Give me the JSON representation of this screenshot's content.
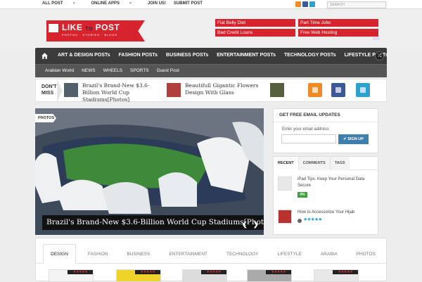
{
  "topbar": {
    "nav": [
      {
        "label": "ALL POST",
        "dropdown": true
      },
      {
        "label": "ONLINE APPS",
        "dropdown": true
      },
      {
        "label": "JOIN US!",
        "dropdown": false
      },
      {
        "label": "SUBMIT POST",
        "dropdown": false
      }
    ],
    "social_icons": [
      "rss-icon",
      "facebook-icon",
      "twitter-icon"
    ],
    "search_placeholder": "SEARCH"
  },
  "logo": {
    "text_a": "LIKE",
    "text_to": "TO",
    "text_b": "POST",
    "tagline": "PHOTOS · STORIES · BLOGS"
  },
  "ads": [
    "Flat Belly Diet",
    "Part Time Jobs",
    "Bad Credit Loans",
    "Free Web Hosting"
  ],
  "main_nav": {
    "items": [
      "ART & DESIGN POSTs",
      "FASHION POSTs",
      "BUSINESS POSTs",
      "ENTERTAINMENT POSTs",
      "TECHNOLOGY POSTs",
      "LIFESTYLE POSTs"
    ]
  },
  "sub_nav": {
    "items": [
      "Arabian World",
      "NEWS",
      "WHEELS",
      "SPORTS",
      "Guest Post"
    ]
  },
  "dont_miss": {
    "label": "DON'T MISS",
    "items": [
      {
        "text": "Brazil's Brand-New $3.6-Billion World Cup Stadiums[Photos]"
      },
      {
        "text": "Beautifull Gigantic Flowers Design With Glass"
      }
    ]
  },
  "slider": {
    "tag": "PHOTOS",
    "caption": "Brazil's Brand-New $3.6-Billion World Cup Stadiums[Photos]",
    "prev": "❮",
    "next": "❯"
  },
  "email_widget": {
    "title": "GET FREE EMAIL UPDATES",
    "label": "Enter your email address",
    "button": "SIGN UP"
  },
  "tab_widget": {
    "tabs": [
      "RECENT",
      "COMMENTS",
      "TAGS"
    ],
    "posts": [
      {
        "title": "iPad Tips: Keep Your Personal Data Secure",
        "badge": "0%"
      },
      {
        "title": "How to Accessorize Your Hijab",
        "stars": "★★★★★"
      }
    ]
  },
  "category_tabs": [
    "DESIGN",
    "FASHION",
    "BUSINESS",
    "ENTERTAINMENT",
    "TECHNOLOGY",
    "LIFESTYLE",
    "ARABIA",
    "PHOTOS"
  ],
  "card_rating": "★★★★★",
  "colors": {
    "accent_red": "#d6232d",
    "nav_dark": "#3b3b3b",
    "signup_blue": "#3f7fb0",
    "badge_green": "#3ba13b"
  }
}
